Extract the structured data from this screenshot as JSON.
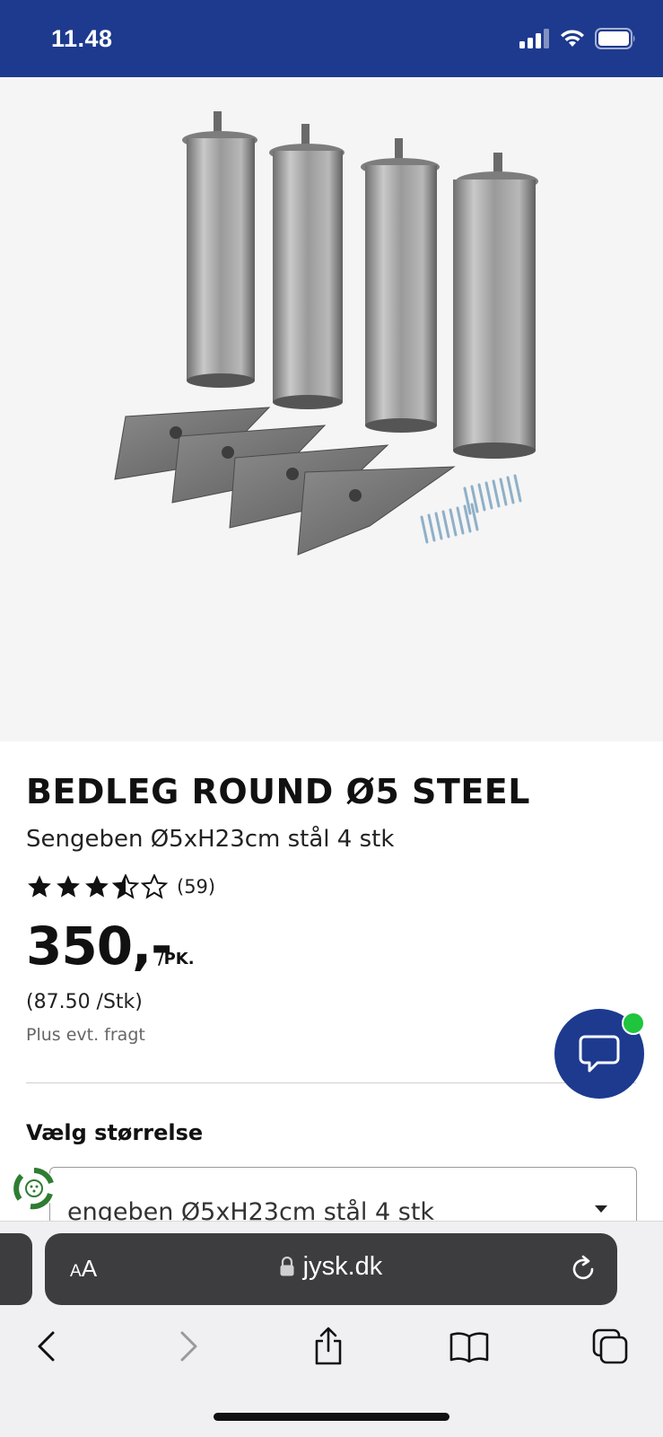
{
  "status_bar": {
    "time": "11.48",
    "icons": [
      "signal-icon",
      "wifi-icon",
      "battery-icon"
    ]
  },
  "product": {
    "image_alt": "bed-legs-product-image",
    "title": "BEDLEG ROUND Ø5 STEEL",
    "subtitle": "Sengeben Ø5xH23cm stål 4 stk",
    "rating": {
      "stars": 3.5,
      "max": 5,
      "count": "(59)"
    },
    "price": "350,-",
    "price_unit": "/PK.",
    "unit_price": "(87.50 /Stk)",
    "freight_note": "Plus evt. fragt"
  },
  "size_selector": {
    "label": "Vælg størrelse",
    "selected": "engeben Ø5xH23cm stål 4 stk"
  },
  "browser": {
    "text_size_label_small": "A",
    "text_size_label_large": "A",
    "url": "jysk.dk"
  },
  "colors": {
    "brand_blue": "#1d3a8f",
    "online_green": "#1ec53d"
  }
}
